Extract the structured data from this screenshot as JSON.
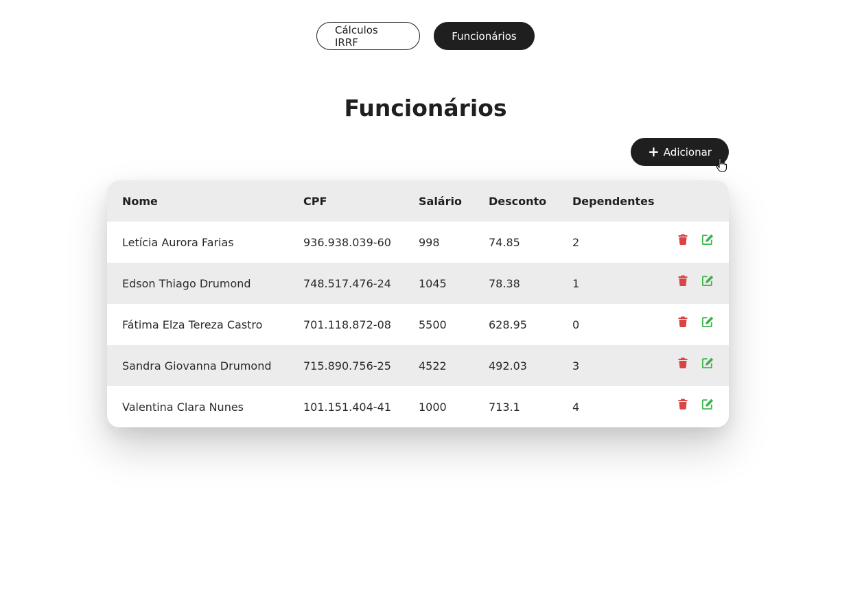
{
  "nav": {
    "tabs": [
      {
        "label": "Cálculos IRRF",
        "active": false
      },
      {
        "label": "Funcionários",
        "active": true
      }
    ]
  },
  "page": {
    "title": "Funcionários",
    "add_label": "Adicionar"
  },
  "table": {
    "headers": {
      "nome": "Nome",
      "cpf": "CPF",
      "salario": "Salário",
      "desconto": "Desconto",
      "dependentes": "Dependentes"
    },
    "rows": [
      {
        "nome": "Letícia Aurora Farias",
        "cpf": "936.938.039-60",
        "salario": "998",
        "desconto": "74.85",
        "dependentes": "2"
      },
      {
        "nome": "Edson Thiago Drumond",
        "cpf": "748.517.476-24",
        "salario": "1045",
        "desconto": "78.38",
        "dependentes": "1"
      },
      {
        "nome": "Fátima Elza Tereza Castro",
        "cpf": "701.118.872-08",
        "salario": "5500",
        "desconto": "628.95",
        "dependentes": "0"
      },
      {
        "nome": "Sandra Giovanna Drumond",
        "cpf": "715.890.756-25",
        "salario": "4522",
        "desconto": "492.03",
        "dependentes": "3"
      },
      {
        "nome": "Valentina Clara Nunes",
        "cpf": "101.151.404-41",
        "salario": "1000",
        "desconto": "713.1",
        "dependentes": "4"
      }
    ]
  },
  "icons": {
    "delete": "trash-icon",
    "edit": "edit-icon",
    "add": "plus-icon"
  },
  "colors": {
    "primary": "#1f1f1f",
    "delete": "#d94545",
    "edit": "#3cb44b",
    "row_alt": "#ececec"
  }
}
